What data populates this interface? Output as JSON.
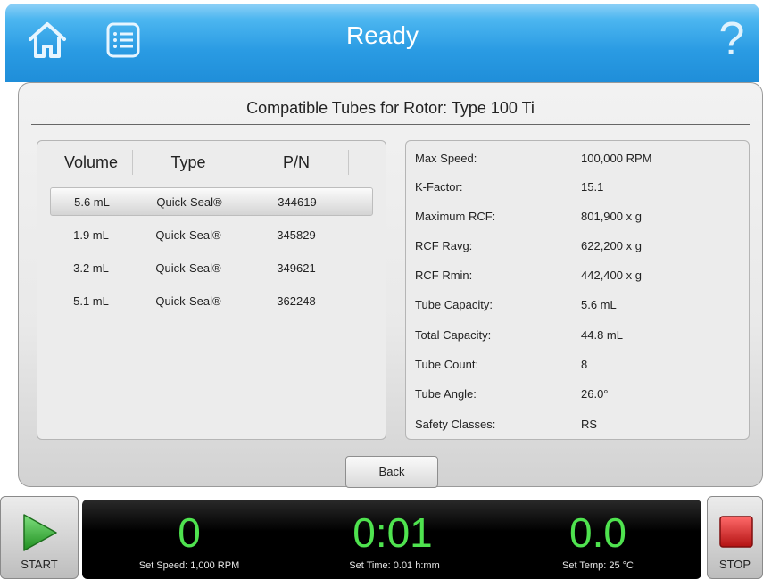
{
  "header": {
    "title": "Ready",
    "help_label": "?"
  },
  "page": {
    "title": "Compatible Tubes for Rotor:  Type 100 Ti"
  },
  "tubes": {
    "columns": [
      "Volume",
      "Type",
      "P/N"
    ],
    "rows": [
      {
        "volume": "5.6 mL",
        "type": "Quick-Seal®",
        "pn": "344619",
        "selected": true
      },
      {
        "volume": "1.9 mL",
        "type": "Quick-Seal®",
        "pn": "345829",
        "selected": false
      },
      {
        "volume": "3.2 mL",
        "type": "Quick-Seal®",
        "pn": "349621",
        "selected": false
      },
      {
        "volume": "5.1 mL",
        "type": "Quick-Seal®",
        "pn": "362248",
        "selected": false
      }
    ]
  },
  "properties": [
    {
      "label": "Max Speed:",
      "value": "100,000 RPM"
    },
    {
      "label": "K-Factor:",
      "value": "15.1"
    },
    {
      "label": "Maximum RCF:",
      "value": "801,900 x g"
    },
    {
      "label": "RCF Ravg:",
      "value": "622,200 x g"
    },
    {
      "label": "RCF Rmin:",
      "value": "442,400 x g"
    },
    {
      "label": "Tube Capacity:",
      "value": "5.6 mL"
    },
    {
      "label": "Total Capacity:",
      "value": "44.8 mL"
    },
    {
      "label": "Tube Count:",
      "value": "8"
    },
    {
      "label": "Tube Angle:",
      "value": "26.0°"
    },
    {
      "label": "Safety Classes:",
      "value": "RS"
    }
  ],
  "buttons": {
    "back": "Back",
    "start": "START",
    "stop": "STOP"
  },
  "status": {
    "speed_value": "0",
    "speed_set": "Set Speed: 1,000 RPM",
    "time_value": "0:01",
    "time_set": "Set Time: 0.01 h:mm",
    "temp_value": "0.0",
    "temp_set": "Set Temp: 25 °C"
  },
  "colors": {
    "header_blue": "#2a9be3",
    "readout_green": "#4fe34f",
    "start_green": "#2fa32f",
    "stop_red": "#d91e1e"
  },
  "icons": {
    "home": "home-icon",
    "list": "list-icon",
    "help": "help-icon",
    "start": "play-icon",
    "stop": "stop-icon"
  }
}
